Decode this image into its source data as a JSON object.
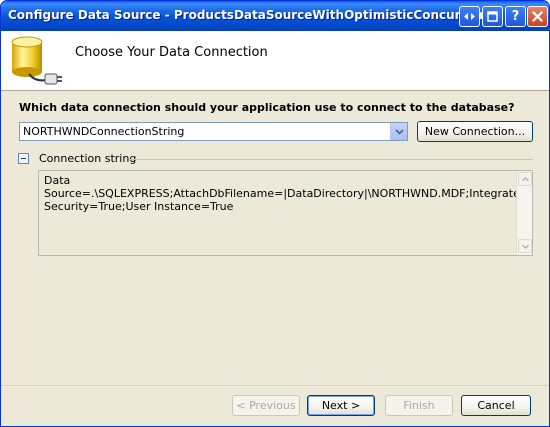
{
  "window": {
    "title": "Configure Data Source - ProductsDataSourceWithOptimisticConcurrency",
    "buttons": {
      "help_label": "?",
      "close_label": "X"
    }
  },
  "header": {
    "icon": "database-connection-icon",
    "title": "Choose Your Data Connection"
  },
  "connection": {
    "question": "Which data connection should your application use to connect to the database?",
    "selected": "NORTHWNDConnectionString",
    "new_connection_label": "New Connection..."
  },
  "connection_string": {
    "label": "Connection string",
    "expanded": true,
    "value": "Data Source=.\\SQLEXPRESS;AttachDbFilename=|DataDirectory|\\NORTHWND.MDF;Integrated Security=True;User Instance=True"
  },
  "footer": {
    "previous_label": "< Previous",
    "next_label": "Next >",
    "finish_label": "Finish",
    "cancel_label": "Cancel"
  },
  "colors": {
    "titlebar": "#0554d8",
    "dialog_bg": "#ece9d8",
    "border": "#0831d9"
  }
}
